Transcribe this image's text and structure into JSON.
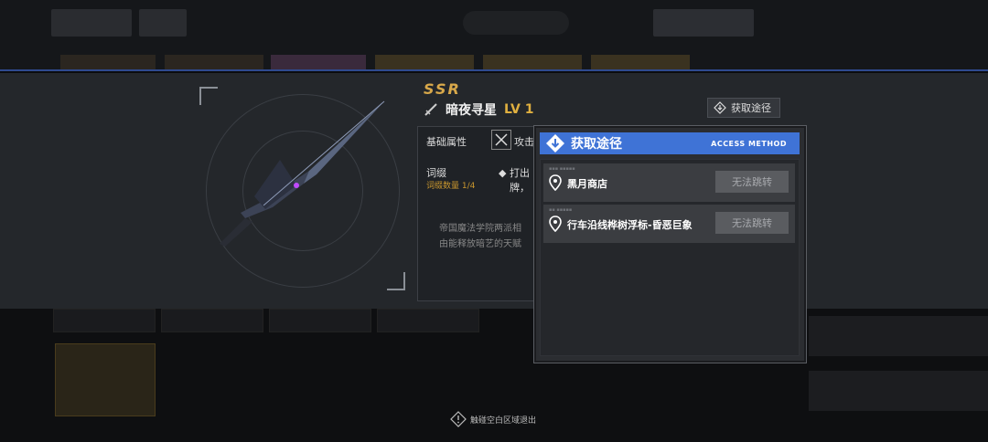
{
  "item": {
    "rarity": "SSR",
    "name": "暗夜寻星",
    "level": "LV 1",
    "acquire_button_label": "获取途径",
    "tabs": {
      "base": "基础属性",
      "attack": "攻击"
    },
    "affix": {
      "label": "词缀",
      "count_text": "词缀数量 1/4",
      "desc_line1": "打出",
      "desc_line2": "牌，"
    },
    "lore": {
      "line1": "帝国魔法学院两派相",
      "line2": "由能释放暗艺的天赋"
    }
  },
  "modal": {
    "title": "获取途径",
    "subtitle": "ACCESS METHOD",
    "sources": [
      {
        "name": "黑月商店",
        "button_label": "无法跳转"
      },
      {
        "name": "行车沿线桦树浮标-昏恶巨象",
        "button_label": "无法跳转"
      }
    ]
  },
  "footer": {
    "exit_hint": "触碰空白区域退出"
  },
  "colors": {
    "accent_blue": "#3f73d6",
    "rarity_gold": "#d8a84a",
    "level_gold": "#e0b040"
  },
  "icons": [
    "sword-icon",
    "download-icon",
    "crossed-swords-icon",
    "location-pin-icon",
    "exit-diamond-icon"
  ]
}
